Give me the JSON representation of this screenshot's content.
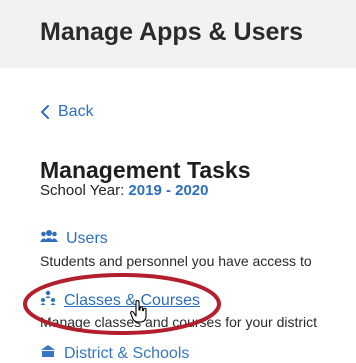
{
  "header": {
    "title": "Manage Apps & Users"
  },
  "nav": {
    "back_label": "Back"
  },
  "section": {
    "title": "Management Tasks",
    "school_year_label": "School Year:",
    "school_year_value": "2019 - 2020"
  },
  "tasks": [
    {
      "label": "Users",
      "icon": "users-icon",
      "description": "Students and personnel you have access to"
    },
    {
      "label": "Classes & Courses",
      "icon": "class-hierarchy-icon",
      "description": "Manage classes and courses for your district"
    },
    {
      "label": "District & Schools",
      "icon": "school-icon"
    }
  ],
  "colors": {
    "link": "#2d6fbf",
    "header_bg": "#f2f2f2",
    "highlight": "#b21f2d"
  }
}
